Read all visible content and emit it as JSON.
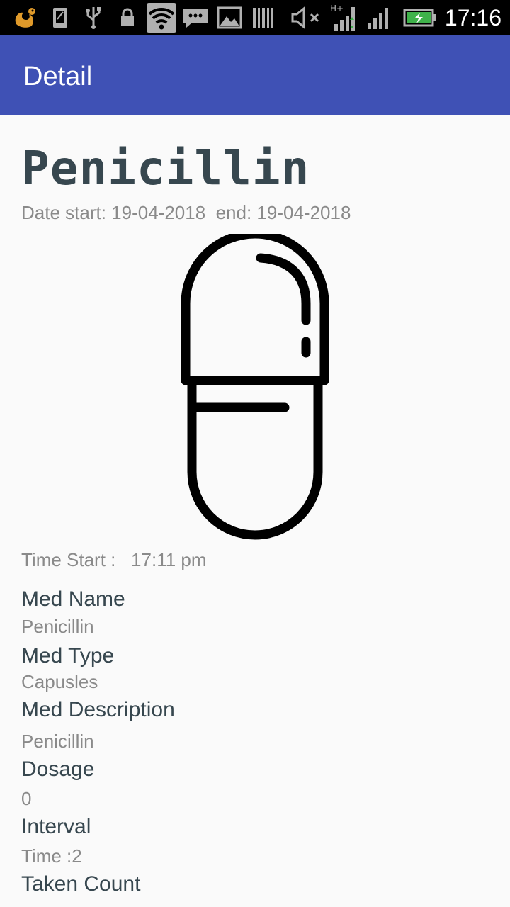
{
  "status_bar": {
    "time": "17:16",
    "icons": [
      "uc-browser-icon",
      "sim-card-icon",
      "usb-icon",
      "lock-icon",
      "wifi-icon",
      "message-icon",
      "image-icon",
      "barcode-icon",
      "mute-icon",
      "mobile-data-icon",
      "signal-icon",
      "battery-charging-icon"
    ],
    "network_label": "H+"
  },
  "app_bar": {
    "title": "Detail"
  },
  "medication": {
    "title": "Penicillin",
    "date_line": "Date start: 19-04-2018  end: 19-04-2018",
    "image_icon": "capsule-icon",
    "time_start": "Time Start :   17:11 pm"
  },
  "fields": [
    {
      "label": "Med Name",
      "value": "Penicillin"
    },
    {
      "label": "Med Type",
      "value": "Capusles"
    },
    {
      "label": "Med Description",
      "value": "Penicillin"
    },
    {
      "label": "Dosage",
      "value": "0"
    },
    {
      "label": "Interval",
      "value": "Time :2"
    },
    {
      "label": "Taken Count",
      "value": ""
    }
  ]
}
